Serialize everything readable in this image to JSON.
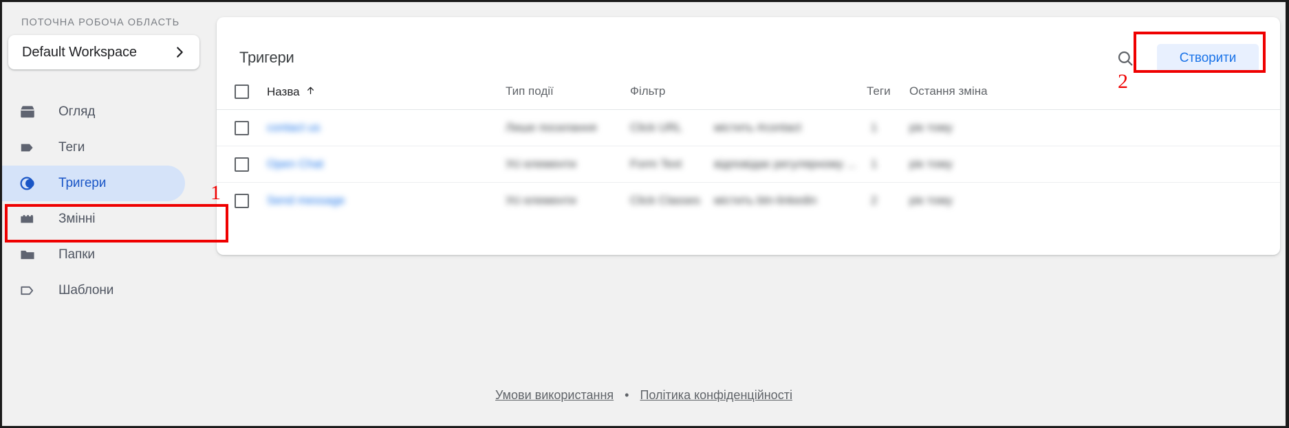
{
  "sidebar": {
    "workspace_label": "ПОТОЧНА РОБОЧА ОБЛАСТЬ",
    "workspace_name": "Default Workspace",
    "chevron_icon": "chevron-right-icon",
    "items": [
      {
        "label": "Огляд",
        "icon": "overview-box-icon",
        "active": false
      },
      {
        "label": "Теги",
        "icon": "tag-icon",
        "active": false
      },
      {
        "label": "Тригери",
        "icon": "trigger-circles-icon",
        "active": true
      },
      {
        "label": "Змінні",
        "icon": "variables-brick-icon",
        "active": false
      },
      {
        "label": "Папки",
        "icon": "folder-icon",
        "active": false
      },
      {
        "label": "Шаблони",
        "icon": "template-tag-outline-icon",
        "active": false
      }
    ]
  },
  "main": {
    "title": "Тригери",
    "search_icon": "search-icon",
    "create_label": "Створити",
    "table": {
      "select_all": "select-all-checkbox",
      "sort_icon": "arrow-up-icon",
      "columns": {
        "name": "Назва",
        "event_type": "Тип події",
        "filter": "Фільтр",
        "tags": "Теги",
        "last_changed": "Остання зміна"
      },
      "rows": [
        {
          "name": "contact us",
          "event_type": "Лише посилання",
          "filter_chip": "Click URL",
          "filter_condition": "містить #contact",
          "tags": "1",
          "last_changed": "рік тому"
        },
        {
          "name": "Open Chat",
          "event_type": "Усі елементи",
          "filter_chip": "Form Text",
          "filter_condition": "відповідає регулярному ...",
          "tags": "1",
          "last_changed": "рік тому"
        },
        {
          "name": "Send message",
          "event_type": "Усі елементи",
          "filter_chip": "Click Classes",
          "filter_condition": "містить btn-linkedin",
          "tags": "2",
          "last_changed": "рік тому"
        }
      ]
    }
  },
  "footer": {
    "terms": "Умови використання",
    "separator": "•",
    "privacy": "Політика конфіденційності"
  },
  "annotations": {
    "one": "1",
    "two": "2",
    "color": "#ef0000"
  },
  "colors": {
    "accent": "#1a73e8",
    "active_pill": "#d5e3f9",
    "page_bg": "#f1f1f1",
    "card_bg": "#ffffff",
    "text_muted": "#5f6368"
  }
}
